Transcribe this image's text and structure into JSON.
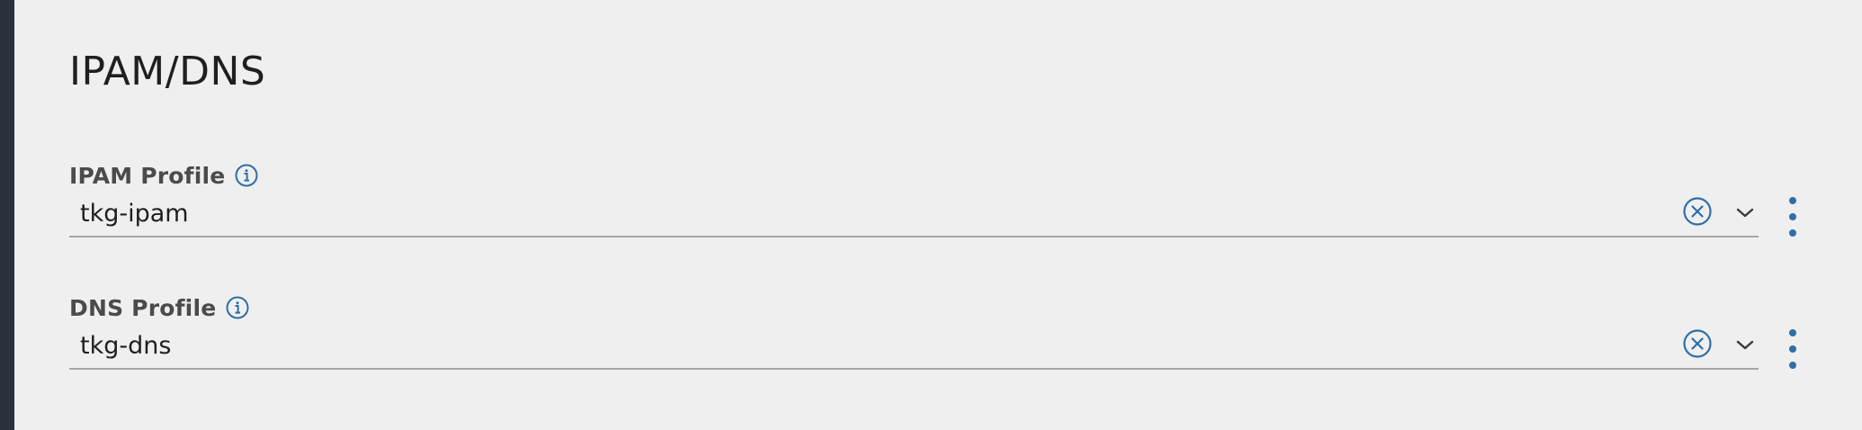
{
  "section": {
    "title": "IPAM/DNS"
  },
  "fields": [
    {
      "label": "IPAM Profile",
      "value": "tkg-ipam",
      "info_icon": "info-icon",
      "clear_icon": "clear-circle-icon",
      "dropdown_icon": "chevron-down-icon",
      "menu_icon": "kebab-menu-icon"
    },
    {
      "label": "DNS Profile",
      "value": "tkg-dns",
      "info_icon": "info-icon",
      "clear_icon": "clear-circle-icon",
      "dropdown_icon": "chevron-down-icon",
      "menu_icon": "kebab-menu-icon"
    }
  ],
  "colors": {
    "background": "#efefef",
    "left_strip": "#28323c",
    "accent_blue": "#2f6ea8",
    "label_gray": "#4b4b4b",
    "underline": "#a6a6a6"
  }
}
